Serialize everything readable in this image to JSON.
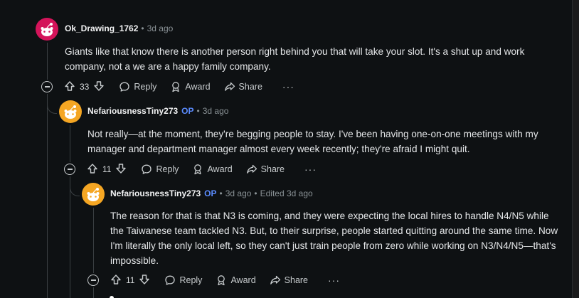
{
  "comments": [
    {
      "username": "Ok_Drawing_1762",
      "time": "3d ago",
      "body": "Giants like that know there is another person right behind you that will take your slot. It's a shut up and work company, not a we are a happy family company.",
      "votes": "33",
      "avatar_color": "#d4145a"
    },
    {
      "username": "NefariousnessTiny273",
      "op_badge": "OP",
      "time": "3d ago",
      "body": "Not really—at the moment, they're begging people to stay. I've been having one-on-one meetings with my manager and department manager almost every week recently; they're afraid I might quit.",
      "votes": "11",
      "avatar_color": "#f5a623"
    },
    {
      "username": "NefariousnessTiny273",
      "op_badge": "OP",
      "time": "3d ago",
      "edited": "Edited 3d ago",
      "body": "The reason for that is that N3 is coming, and they were expecting the local hires to handle N4/N5 while the Taiwanese team tackled N3. But, to their surprise, people started quitting around the same time. Now I'm literally the only local left, so they can't just train people from zero while working on N3/N4/N5—that's impossible.",
      "votes": "11",
      "avatar_color": "#f5a623"
    }
  ],
  "actions": {
    "reply": "Reply",
    "award": "Award",
    "share": "Share",
    "more": "···"
  },
  "icons": [
    "upvote-icon",
    "downvote-icon",
    "reply-icon",
    "award-icon",
    "share-icon",
    "collapse-icon",
    "more-icon"
  ]
}
